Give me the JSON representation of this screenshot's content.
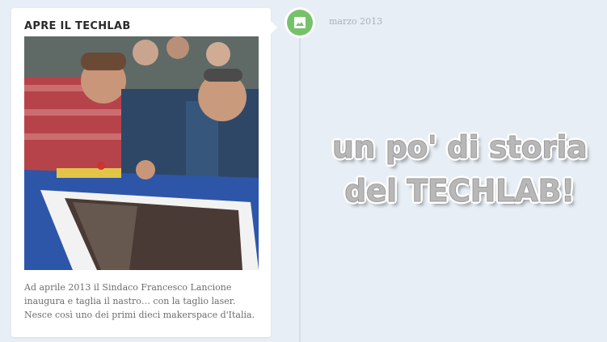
{
  "card": {
    "title": "APRE IL TECHLAB",
    "photo_alt": "Sindaco al taglio laser",
    "text": "Ad aprile 2013 il Sindaco Francesco Lancione inaugura e taglia il nastro… con la taglio laser. Nesce così uno dei primi dieci makerspace d'Italia."
  },
  "timeline": {
    "date": "marzo 2013",
    "marker_icon": "image-icon",
    "marker_color": "#76c26b"
  },
  "headline": {
    "line1": "un po' di storia",
    "line2": "del TECHLAB!"
  }
}
